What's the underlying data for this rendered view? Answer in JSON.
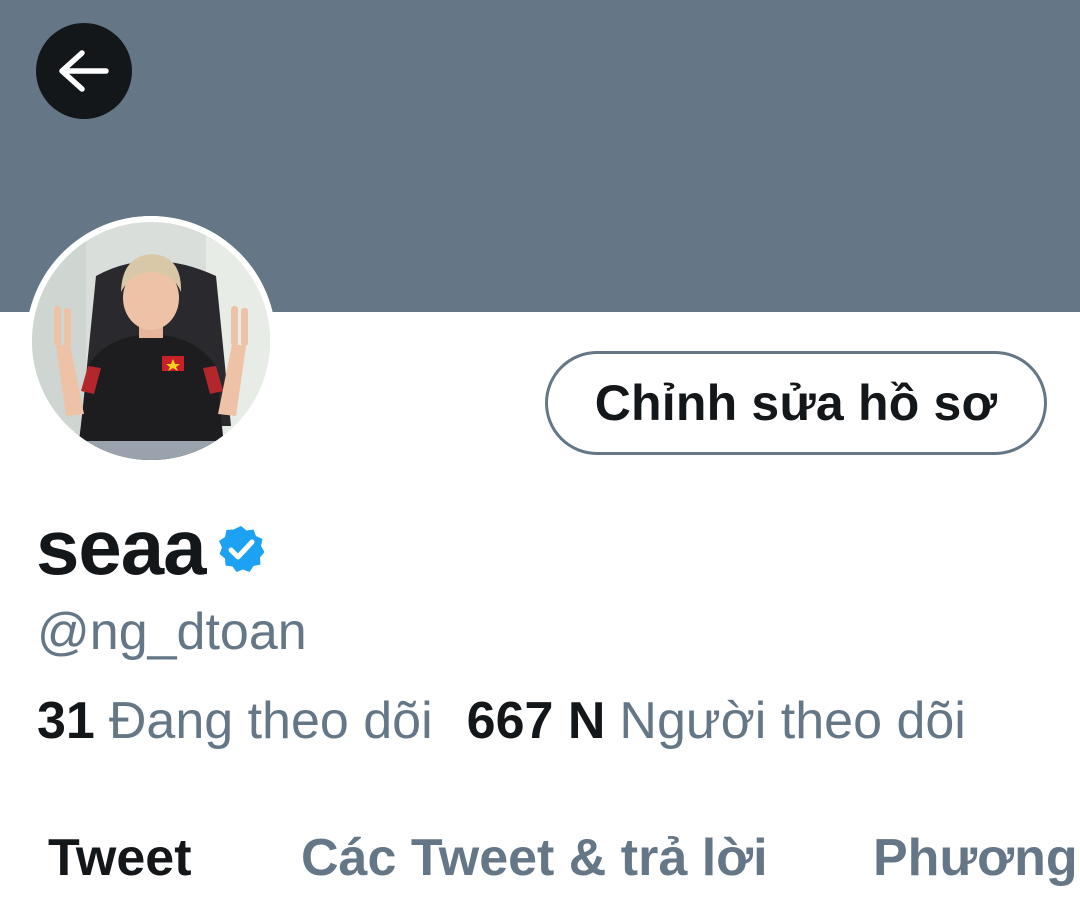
{
  "header": {
    "banner_color": "#657786",
    "back_icon": "arrow-left-icon"
  },
  "profile": {
    "edit_button_label": "Chỉnh sửa hồ sơ",
    "display_name": "seaa",
    "verified_icon": "verified-badge-icon",
    "handle": "@ng_dtoan",
    "following_count": "31",
    "following_label": "Đang theo dõi",
    "followers_count": "667 N",
    "followers_label": "Người theo dõi"
  },
  "tabs": [
    {
      "label": "Tweet",
      "active": true
    },
    {
      "label": "Các Tweet & trả lời",
      "active": false
    },
    {
      "label": "Phương",
      "active": false
    }
  ],
  "colors": {
    "text_primary": "#14171a",
    "text_secondary": "#657786",
    "verified_blue": "#1da1f2"
  }
}
